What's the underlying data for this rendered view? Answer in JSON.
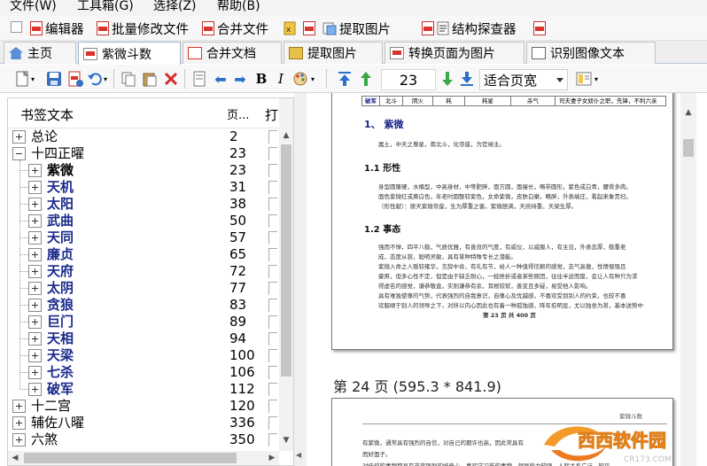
{
  "menu": [
    {
      "label": "文件(W)"
    },
    {
      "label": "工具箱(G)"
    },
    {
      "label": "选择(Z)"
    },
    {
      "label": "帮助(B)"
    }
  ],
  "quickbar": {
    "editor": "编辑器",
    "batch_modify": "批量修改文件",
    "merge_files": "合并文件",
    "extract_images": "提取图片",
    "structure_explorer": "结构探查器"
  },
  "tabs": [
    {
      "label": "主页",
      "icon": "home-icon"
    },
    {
      "label": "紫微斗数",
      "icon": "pdf-doc-icon",
      "active": true
    },
    {
      "label": "合并文档",
      "icon": "merge-icon"
    },
    {
      "label": "提取图片",
      "icon": "image-extract-icon"
    },
    {
      "label": "转换页面为图片",
      "icon": "convert-icon"
    },
    {
      "label": "识别图像文本",
      "icon": "ocr-icon"
    }
  ],
  "toolbar": {
    "bold": "B",
    "italic": "I",
    "page_number": "23",
    "zoom_value": "适合页宽"
  },
  "bookmarks": {
    "header_title": "书签文本",
    "header_page": "页...",
    "header_open": "打",
    "rows": [
      {
        "title": "总论",
        "page": "2",
        "level": 0,
        "expander": "plus",
        "style": "normal"
      },
      {
        "title": "十四正曜",
        "page": "23",
        "level": 0,
        "expander": "minus",
        "style": "normal"
      },
      {
        "title": "紫微",
        "page": "23",
        "level": 1,
        "expander": "plus",
        "style": "bold-black"
      },
      {
        "title": "天机",
        "page": "31",
        "level": 1,
        "expander": "plus",
        "style": "blue"
      },
      {
        "title": "太阳",
        "page": "38",
        "level": 1,
        "expander": "plus",
        "style": "blue"
      },
      {
        "title": "武曲",
        "page": "50",
        "level": 1,
        "expander": "plus",
        "style": "blue"
      },
      {
        "title": "天同",
        "page": "57",
        "level": 1,
        "expander": "plus",
        "style": "blue"
      },
      {
        "title": "廉贞",
        "page": "65",
        "level": 1,
        "expander": "plus",
        "style": "blue"
      },
      {
        "title": "天府",
        "page": "72",
        "level": 1,
        "expander": "plus",
        "style": "blue"
      },
      {
        "title": "太阴",
        "page": "77",
        "level": 1,
        "expander": "plus",
        "style": "blue"
      },
      {
        "title": "贪狼",
        "page": "83",
        "level": 1,
        "expander": "plus",
        "style": "blue"
      },
      {
        "title": "巨门",
        "page": "89",
        "level": 1,
        "expander": "plus",
        "style": "blue"
      },
      {
        "title": "天相",
        "page": "94",
        "level": 1,
        "expander": "plus",
        "style": "blue"
      },
      {
        "title": "天梁",
        "page": "100",
        "level": 1,
        "expander": "plus",
        "style": "blue"
      },
      {
        "title": "七杀",
        "page": "106",
        "level": 1,
        "expander": "plus",
        "style": "blue"
      },
      {
        "title": "破军",
        "page": "112",
        "level": 1,
        "expander": "plus",
        "style": "blue"
      },
      {
        "title": "十二宫",
        "page": "120",
        "level": 0,
        "expander": "plus",
        "style": "normal"
      },
      {
        "title": "辅佐八曜",
        "page": "336",
        "level": 0,
        "expander": "plus",
        "style": "normal"
      },
      {
        "title": "六煞",
        "page": "350",
        "level": 0,
        "expander": "plus",
        "style": "normal"
      }
    ]
  },
  "document": {
    "page23": {
      "table_row": [
        "破军",
        "北斗",
        "阴火",
        "耗",
        "耗星",
        "杀气",
        "司夫妻子女奴仆之职，先锋，不利六亲"
      ],
      "section_title": "1、   紫微",
      "section_desc": "属土，中天之尊星，南北斗，化帝座，为官禄主。",
      "sub1_title": "1.1     形性",
      "sub1_lines": [
        "身型圆隆硬，水桶型，中高身材，中等肥胖，面方圆，面瘦长，略带圆形，紫色或白青，腰背多肉。",
        "面色紫微红或黄白色，年老时圆整较紫色，女命紫微，皮肤白嫩，略胖，外表端庄，看起来象贵妇。",
        "（形性献）：原天紫微帝座，生为厚重之客。紫微胆满，天府持重，天梁生厚。"
      ],
      "sub2_title": "1.2     事态",
      "sub2_lines": [
        "强而不惮，四平八稳，气质优雅，有善良的气度，有威仪，以威服人，有主见，外表忠厚，稳重老",
        "成，态度从容，聪明灵敏，具有某种特殊专长之潜能。",
        "紫微入命之人贩较雍华，言辞中肯，有礼有节，给人一种值得信赖的感觉，志气高傲，性情倔强且",
        "豪爽，但多心性不定，但是由于缺乏耐心，一经挫折或者某些原因，往往半途而废，会让人有种只为求",
        "得虚名的感觉，谦恭敬直，实则谦恭有余，耳根较软，善变且多疑，易受他人影响。",
        "具有难独使尊的气势，代表强烈的自我意识，自尊心及优越感，不喜欢受到别人的约束，也较不喜",
        "欢服顺于别人的领导之下，对所以内心因此也有着一种孤独感，降年愈明显，尤以独坐为甚，基本送势中"
      ],
      "footer": "第 23 页 共 400 页"
    },
    "page_label": "第 24 页 (595.3 * 841.9)",
    "page24": {
      "header": "紫微斗数",
      "lines": [
        "有紫微，通常具有强烈的自信，对自己的期许也高，因此常具有",
        "而好面子。",
        "对任何的事物都具有非常强烈的好奇心，喜欢学习新的事物，领导能力较强，人际关系广泛，知见"
      ]
    }
  },
  "watermark": {
    "brand": "西西软件园",
    "url": "CR173.COM"
  }
}
